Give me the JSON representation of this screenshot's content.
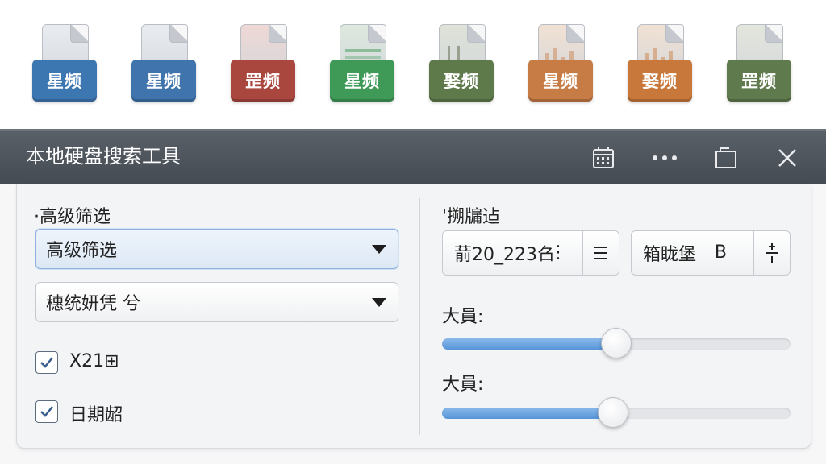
{
  "files": [
    {
      "label": "星频",
      "color": "#3d77b2",
      "tint": "#e9edf2",
      "deco": "blank"
    },
    {
      "label": "星频",
      "color": "#3f74ad",
      "tint": "#e9edf2",
      "deco": "blank"
    },
    {
      "label": "罡频",
      "color": "#a9473f",
      "tint": "#efd8d5",
      "deco": "blank"
    },
    {
      "label": "星频",
      "color": "#3f9a58",
      "tint": "#dde8de",
      "deco": "sheet"
    },
    {
      "label": "娶频",
      "color": "#5e7a4a",
      "tint": "#dee2d8",
      "deco": "cols"
    },
    {
      "label": "星频",
      "color": "#c77c45",
      "tint": "#f1e1d3",
      "deco": "bars"
    },
    {
      "label": "娶频",
      "color": "#c8783a",
      "tint": "#f1e1d3",
      "deco": "bars"
    },
    {
      "label": "罡频",
      "color": "#5f7a4c",
      "tint": "#e3e6dc",
      "deco": "blank"
    }
  ],
  "window": {
    "title": "本地硬盘搜索工具",
    "icons": [
      "calendar-icon",
      "more-icon",
      "restore-icon",
      "close-icon"
    ]
  },
  "left": {
    "section_label": "·高级筛选",
    "dropdown1": {
      "value": "高级筛选"
    },
    "dropdown2": {
      "value": "穗统妍凭 兮"
    },
    "checkboxes": [
      {
        "label": "X21⊞",
        "checked": true
      },
      {
        "label": "日期龆",
        "checked": true
      }
    ]
  },
  "right": {
    "section_label": "'搠牖迠",
    "field1": {
      "value": "葥20_223𠮥",
      "extra": "⋮"
    },
    "field2": {
      "value": "箱眬堡",
      "extra": "B"
    },
    "slider1": {
      "label": "大員:",
      "value": 0.5
    },
    "slider2": {
      "label": "大員:",
      "value": 0.49
    }
  }
}
